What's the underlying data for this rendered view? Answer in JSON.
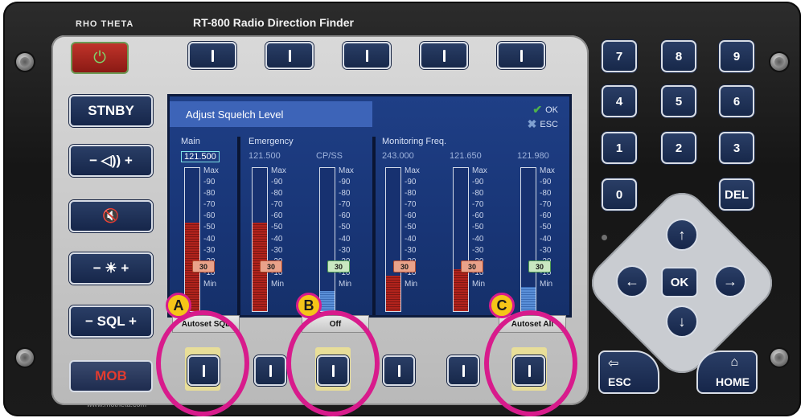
{
  "device": {
    "title": "RT-800 Radio Direction Finder",
    "brand": "RHO THETA",
    "website": "www.rhotheta.com"
  },
  "left_buttons": {
    "stnby": "STNBY",
    "volume": "− ◁)) +",
    "mute": "🔇",
    "brightness": "− ☀ +",
    "sql": "− SQL +",
    "mob": "MOB"
  },
  "screen": {
    "title": "Adjust Squelch Level",
    "ok_label": "OK",
    "esc_label": "ESC",
    "groups": {
      "main": "Main",
      "emergency": "Emergency",
      "monitoring": "Monitoring Freq."
    },
    "channels": [
      {
        "freq": "121.500",
        "sublabel": "",
        "level": 0.62,
        "threshold": "30",
        "marker": "red",
        "fill": "red"
      },
      {
        "freq": "121.500",
        "sublabel": "",
        "level": 0.62,
        "threshold": "30",
        "marker": "red",
        "fill": "red"
      },
      {
        "freq": "",
        "sublabel": "CP/SS",
        "level": 0.14,
        "threshold": "30",
        "marker": "green",
        "fill": "blue"
      },
      {
        "freq": "243.000",
        "sublabel": "",
        "level": 0.25,
        "threshold": "30",
        "marker": "red",
        "fill": "red"
      },
      {
        "freq": "121.650",
        "sublabel": "",
        "level": 0.29,
        "threshold": "30",
        "marker": "red",
        "fill": "red"
      },
      {
        "freq": "121.980",
        "sublabel": "",
        "level": 0.17,
        "threshold": "30",
        "marker": "green",
        "fill": "blue"
      }
    ],
    "scale": [
      "Max",
      "-90",
      "-80",
      "-70",
      "-60",
      "-50",
      "-40",
      "-30",
      "-20",
      "-10",
      "Min"
    ]
  },
  "softkeys": {
    "a_label": "Autoset SQL",
    "b_label": "Off",
    "c_label": "Autoset All"
  },
  "annotations": {
    "a": "A",
    "b": "B",
    "c": "C",
    "color": "#d81b8c"
  },
  "keypad": {
    "k7": "7",
    "k8": "8",
    "k9": "9",
    "k4": "4",
    "k5": "5",
    "k6": "6",
    "k1": "1",
    "k2": "2",
    "k3": "3",
    "k0": "0",
    "del": "DEL"
  },
  "nav": {
    "up": "↑",
    "down": "↓",
    "left": "←",
    "right": "→",
    "ok": "OK",
    "esc": "ESC",
    "esc_icon": "⇦",
    "home": "HOME",
    "home_icon": "⌂"
  }
}
